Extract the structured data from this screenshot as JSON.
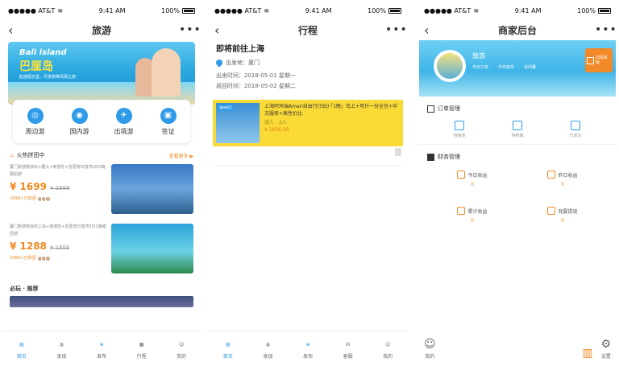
{
  "status": {
    "carrier": "●●●●● AT&T",
    "time": "9:41 AM",
    "battery": "100%"
  },
  "colors": {
    "accent_blue": "#2f9be8",
    "accent_orange": "#f08a24",
    "highlight_yellow": "#fada36"
  },
  "screen1": {
    "title": "旅游",
    "banner": {
      "title_en": "Bali island",
      "title_cn": "巴厘岛",
      "tagline": "赴度假天堂，尽享热带风情之旅"
    },
    "categories": [
      {
        "label": "周边游",
        "icon": "map-icon"
      },
      {
        "label": "国内游",
        "icon": "globe-icon"
      },
      {
        "label": "出境游",
        "icon": "plane-icon"
      },
      {
        "label": "签证",
        "icon": "visa-icon"
      }
    ],
    "hot_section": {
      "title": "火热拼团中",
      "more": "查看更多 ▶"
    },
    "deals": [
      {
        "desc": "厦门旅游鼓浪屿+厦大+南普陀+曾厝垵日落湾3日3晚跟团游",
        "price": "¥ 1699",
        "old_price": "¥ 2699",
        "joined": "1898人已拼团"
      },
      {
        "desc": "厦门旅游鼓浪屿上岛+南普陀+曾厝垵日落湾3日2晚跟团游",
        "price": "¥ 1288",
        "old_price": "¥ 1555",
        "joined": "1568人已拼团"
      }
    ],
    "recommend_title": "必玩 · 推荐",
    "tabs": [
      {
        "label": "首页",
        "icon": "home-icon",
        "active": true
      },
      {
        "label": "发现",
        "icon": "compass-icon",
        "active": false
      },
      {
        "label": "发布",
        "icon": "publish-icon",
        "active": false
      },
      {
        "label": "行程",
        "icon": "calendar-icon",
        "active": false
      },
      {
        "label": "我的",
        "icon": "user-icon",
        "active": false
      }
    ]
  },
  "screen2": {
    "title": "行程",
    "heading": "即将前往上海",
    "origin_label": "出发地：厦门",
    "depart": "出发时间：2018-05-01 星期一",
    "return": "返回时间：2018-05-02 星期二",
    "card": {
      "image_tag": "澳洲悉尼",
      "text": "上海阿玛瑞Amari自由行(5钻)·「1晚」岛上+可升一份全包+中文服务+高性价比",
      "adult": "成人　2人",
      "amount": "¥ 1856.00"
    },
    "tabs": [
      {
        "label": "首页",
        "icon": "home-icon",
        "active": true
      },
      {
        "label": "发现",
        "icon": "compass-icon",
        "active": false
      },
      {
        "label": "发布",
        "icon": "publish-icon",
        "active": false
      },
      {
        "label": "客服",
        "icon": "headset-icon",
        "active": false
      },
      {
        "label": "我的",
        "icon": "user-icon",
        "active": false
      }
    ]
  },
  "screen3": {
    "title": "商家后台",
    "shop_name": "旅游",
    "stats": [
      "今日订单",
      "今日成交",
      "访问量"
    ],
    "verify_label": "扫码核销",
    "order_section": "订单管理",
    "orders": [
      {
        "label": "待接单",
        "value": "0"
      },
      {
        "label": "待核销",
        "value": "0"
      },
      {
        "label": "已成功",
        "value": "0"
      }
    ],
    "finance_section": "财务管理",
    "finance": [
      {
        "label": "今日收益",
        "value": "0"
      },
      {
        "label": "昨日收益",
        "value": "0"
      },
      {
        "label": "累计收益",
        "value": "0"
      },
      {
        "label": "我要提现",
        "value": "0"
      }
    ],
    "mine_label": "我的",
    "settings_label": "设置"
  }
}
